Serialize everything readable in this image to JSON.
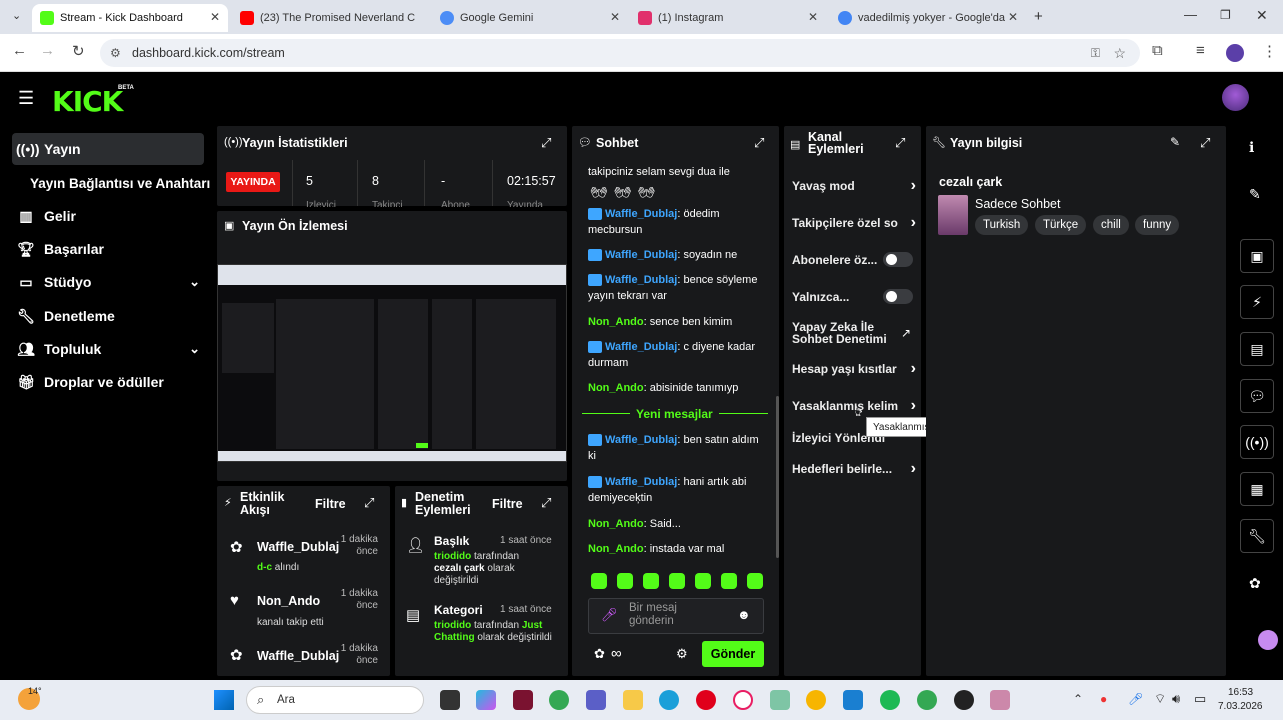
{
  "browser": {
    "tabs": [
      {
        "title": "Stream - Kick Dashboard",
        "active": true,
        "favicon_color": "#53fc18"
      },
      {
        "title": "(23) The Promised Neverland C",
        "active": false,
        "favicon_color": "#ff0000"
      },
      {
        "title": "Google Gemini",
        "active": false,
        "favicon_color": "#4c8df6"
      },
      {
        "title": "(1) Instagram",
        "active": false,
        "favicon_color": "#e1306c"
      },
      {
        "title": "vadedilmiş yokyer - Google'da",
        "active": false,
        "favicon_color": "#4285f4"
      }
    ],
    "url": "dashboard.kick.com/stream"
  },
  "header": {
    "logo": "KICK",
    "logo_badge": "BETA"
  },
  "sidebar": {
    "items": [
      {
        "label": "Yayın",
        "icon": "broadcast-icon"
      },
      {
        "label": "Yayın Bağlantısı ve Anahtarı",
        "icon": ""
      },
      {
        "label": "Gelir",
        "icon": "chart-icon"
      },
      {
        "label": "Başarılar",
        "icon": "trophy-icon"
      },
      {
        "label": "Stüdyo",
        "icon": "studio-icon"
      },
      {
        "label": "Denetleme",
        "icon": "wrench-icon"
      },
      {
        "label": "Topluluk",
        "icon": "users-icon"
      },
      {
        "label": "Droplar ve ödüller",
        "icon": "gift-icon"
      }
    ]
  },
  "stats": {
    "title": "Yayın İstatistikleri",
    "live_badge": "YAYINDA",
    "values": [
      "5",
      "8",
      "-",
      "02:15:57"
    ],
    "labels": [
      "İzleyici",
      "Takipçi",
      "Abone",
      "Yayında"
    ]
  },
  "preview": {
    "title": "Yayın Ön İzlemesi"
  },
  "activity": {
    "title": "Etkinlik Akışı",
    "filter": "Filtre",
    "items": [
      {
        "user": "Waffle_Dublaj",
        "time": "1 dakika önce",
        "sub_green": "d-c",
        "sub_rest": " alındı"
      },
      {
        "user": "Non_Ando",
        "time": "1 dakika önce",
        "sub_green": "",
        "sub_rest": "kanalı takip etti"
      },
      {
        "user": "Waffle_Dublaj",
        "time": "1 dakika önce",
        "sub_green": "",
        "sub_rest": ""
      }
    ]
  },
  "mod_actions": {
    "title": "Denetim Eylemleri",
    "filter": "Filtre",
    "items": [
      {
        "type": "Başlık",
        "time": "1 saat önce",
        "actor": "triodido",
        "mid": " tarafından ",
        "value": "cezalı çark",
        "tail": " olarak değiştirildi"
      },
      {
        "type": "Kategori",
        "time": "1 saat önce",
        "actor": "triodido",
        "mid": " tarafından ",
        "value": "Just Chatting",
        "tail": " olarak değiştirildi"
      }
    ]
  },
  "chat": {
    "title": "Sohbet",
    "messages": [
      {
        "user": "",
        "text": "takipciniz selam sevgi dua ile"
      },
      {
        "user": "Waffle_Dublaj",
        "text": "ödedim mecbursun",
        "badge": true
      },
      {
        "user": "Waffle_Dublaj",
        "text": "soyadın ne",
        "badge": true
      },
      {
        "user": "Waffle_Dublaj",
        "text": "bence söyleme yayın tekrarı var",
        "badge": true
      },
      {
        "user": "Non_Ando",
        "text": "sence ben kimim",
        "badge": false
      },
      {
        "user": "Waffle_Dublaj",
        "text": "c diyene kadar durmam",
        "badge": true
      },
      {
        "user": "Non_Ando",
        "text": "abisinide tanımıyp",
        "badge": false
      },
      {
        "user": "Waffle_Dublaj",
        "text": "ben satın aldım ki",
        "badge": true
      },
      {
        "user": "Waffle_Dublaj",
        "text": "hani artık abi demiyeceķtin",
        "badge": true
      },
      {
        "user": "Non_Ando",
        "text": "Said...",
        "badge": false
      },
      {
        "user": "Non_Ando",
        "text": "instada var mal",
        "badge": false
      }
    ],
    "new_messages": "Yeni mesajlar",
    "input_placeholder": "Bir mesaj gönderin",
    "send": "Gönder",
    "infinity": "∞"
  },
  "channel_actions": {
    "title": "Kanal Eylemleri",
    "items": [
      {
        "label": "Yavaş mod",
        "control": "chevron"
      },
      {
        "label": "Takipçilere özel so",
        "control": "chevron"
      },
      {
        "label": "Abonelere öz...",
        "control": "toggle"
      },
      {
        "label": "Yalnızca...",
        "control": "toggle"
      },
      {
        "label": "Yapay Zeka İle Sohbet Denetimi",
        "control": "external"
      },
      {
        "label": "Hesap yaşı kısıtlar",
        "control": "chevron"
      },
      {
        "label": "Yasaklanmış kelim",
        "control": "chevron"
      },
      {
        "label": "İzleyici Yönlendi",
        "control": "none"
      },
      {
        "label": "Hedefleri belirle...",
        "control": "chevron"
      }
    ],
    "tooltip": "Yasaklanmış kelimeler"
  },
  "stream_info": {
    "title": "Yayın bilgisi",
    "stream_title": "cezalı çark",
    "category": "Sadece Sohbet",
    "tags": [
      "Turkish",
      "Türkçe",
      "chill",
      "funny"
    ]
  },
  "taskbar": {
    "temp": "14°",
    "search": "Ara",
    "time": "16:53",
    "date": "7.03.2026"
  }
}
